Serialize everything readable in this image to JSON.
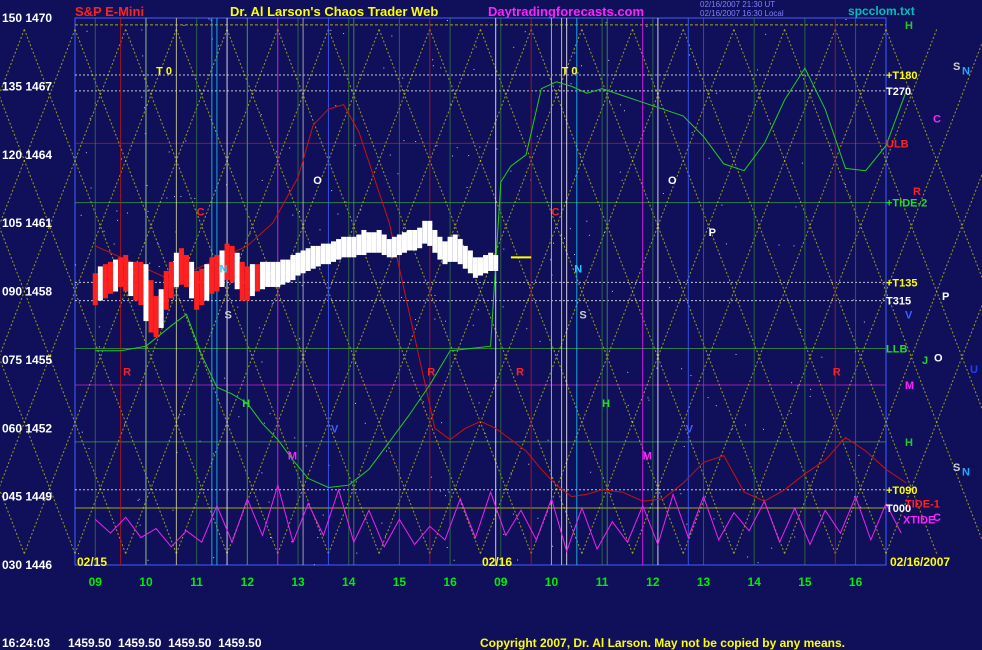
{
  "header": {
    "instrument": "S&P E-Mini",
    "site_title": "Dr. Al Larson's Chaos Trader Web",
    "site_url": "Daytradingforecasts.com",
    "stamp1": "02/16/2007 21:30 UT",
    "stamp2": "02/16/2007 16:30 Local",
    "file": "spcclom.txt"
  },
  "footer": {
    "time": "16:24:03",
    "quotes": "1459.50  1459.50  1459.50  1459.50",
    "copyright": "Copyright 2007, Dr. Al Larson. May not be copied by any means."
  },
  "colors": {
    "background": "#10105a",
    "axis_text": "#ffffff",
    "x_text": "#00ee00",
    "grid_yellow": "#d8d800",
    "grid_green": "#3fa03f",
    "price_bar": "#ffffff",
    "price_bar_red": "#ff2020",
    "tide_green": "#22cc22",
    "line_red": "#cc1010",
    "xtide_magenta": "#ee22ee"
  },
  "chart_data": {
    "type": "line",
    "title": "S&P E-Mini",
    "xlabel": "",
    "ylabel": "",
    "ylim": [
      1446,
      1470
    ],
    "y_ticks": [
      {
        "left": "150",
        "value": 1470
      },
      {
        "left": "135",
        "value": 1467
      },
      {
        "left": "120",
        "value": 1464
      },
      {
        "left": "105",
        "value": 1461
      },
      {
        "left": "090",
        "value": 1458
      },
      {
        "left": "075",
        "value": 1455
      },
      {
        "left": "060",
        "value": 1452
      },
      {
        "left": "045",
        "value": 1449
      },
      {
        "left": "030",
        "value": 1446
      }
    ],
    "x_ticks": [
      "09",
      "10",
      "11",
      "12",
      "13",
      "14",
      "15",
      "16",
      "09",
      "10",
      "11",
      "12",
      "13",
      "14",
      "15",
      "16"
    ],
    "date_labels": [
      "02/15",
      "02/16",
      "02/16/2007"
    ],
    "last_price": 1459.5,
    "right_labels": [
      {
        "text": "H",
        "value": 1469.7,
        "color": "#22cc22"
      },
      {
        "text": "+T180",
        "value": 1467.5,
        "color": "#ffff00"
      },
      {
        "text": "T270",
        "value": 1466.8,
        "color": "#ffffff"
      },
      {
        "text": "ULB",
        "value": 1464.5,
        "color": "#ff2020"
      },
      {
        "text": "+TIDE-2",
        "value": 1461.9,
        "color": "#22dd22"
      },
      {
        "text": "+T135",
        "value": 1458.4,
        "color": "#ffff00"
      },
      {
        "text": "T315",
        "value": 1457.6,
        "color": "#ffffff"
      },
      {
        "text": "V",
        "value": 1457.0,
        "color": "#4060ff"
      },
      {
        "text": "LLB",
        "value": 1455.5,
        "color": "#22dd22"
      },
      {
        "text": "M",
        "value": 1453.9,
        "color": "#ff22ff"
      },
      {
        "text": "H",
        "value": 1451.4,
        "color": "#22cc22"
      },
      {
        "text": "+T090",
        "value": 1449.3,
        "color": "#ffff00"
      },
      {
        "text": "T000",
        "value": 1448.5,
        "color": "#ffffff"
      },
      {
        "text": "TIDE-1",
        "value": 1448.7,
        "color": "#ff2020"
      },
      {
        "text": "XTIDE",
        "value": 1448.0,
        "color": "#ff22ff"
      }
    ],
    "far_right_labels": [
      {
        "text": "S",
        "value": 1467.9,
        "color": "#cccccc"
      },
      {
        "text": "N",
        "value": 1467.7,
        "color": "#22aaff"
      },
      {
        "text": "C",
        "value": 1465.6,
        "color": "#ff22ff"
      },
      {
        "text": "R",
        "value": 1462.4,
        "color": "#ff2020"
      },
      {
        "text": "P",
        "value": 1457.8,
        "color": "#ffffff"
      },
      {
        "text": "J",
        "value": 1455.0,
        "color": "#22dd22"
      },
      {
        "text": "O",
        "value": 1455.1,
        "color": "#ffffff"
      },
      {
        "text": "U",
        "value": 1454.6,
        "color": "#2040ff"
      },
      {
        "text": "S",
        "value": 1450.3,
        "color": "#cccccc"
      },
      {
        "text": "N",
        "value": 1450.1,
        "color": "#22aaff"
      },
      {
        "text": "C",
        "value": 1448.1,
        "color": "#ff22ff"
      }
    ],
    "plot_labels": [
      {
        "text": "T 0",
        "t": 1.2,
        "value": 1467.7,
        "color": "#ffff00"
      },
      {
        "text": "T 0",
        "t": 9.2,
        "value": 1467.7,
        "color": "#ffff00"
      },
      {
        "text": "O",
        "t": 4.3,
        "value": 1462.9,
        "color": "#ffffff"
      },
      {
        "text": "O",
        "t": 11.3,
        "value": 1462.9,
        "color": "#ffffff"
      },
      {
        "text": "C",
        "t": 2.0,
        "value": 1461.5,
        "color": "#ff2020"
      },
      {
        "text": "C",
        "t": 9.0,
        "value": 1461.5,
        "color": "#ff2020"
      },
      {
        "text": "P",
        "t": 12.1,
        "value": 1460.6,
        "color": "#ffffff"
      },
      {
        "text": "N",
        "t": 2.45,
        "value": 1459.0,
        "color": "#22ccff"
      },
      {
        "text": "N",
        "t": 9.45,
        "value": 1459.0,
        "color": "#22ccff"
      },
      {
        "text": "S",
        "t": 2.55,
        "value": 1457.0,
        "color": "#cccccc"
      },
      {
        "text": "S",
        "t": 9.55,
        "value": 1457.0,
        "color": "#cccccc"
      },
      {
        "text": "R",
        "t": 0.55,
        "value": 1454.5,
        "color": "#ff2020"
      },
      {
        "text": "R",
        "t": 6.55,
        "value": 1454.5,
        "color": "#ff2020"
      },
      {
        "text": "R",
        "t": 8.3,
        "value": 1454.5,
        "color": "#ff2020"
      },
      {
        "text": "R",
        "t": 14.55,
        "value": 1454.5,
        "color": "#ff2020"
      },
      {
        "text": "H",
        "t": 2.9,
        "value": 1453.1,
        "color": "#22dd22"
      },
      {
        "text": "H",
        "t": 10.0,
        "value": 1453.1,
        "color": "#22dd22"
      },
      {
        "text": "V",
        "t": 4.65,
        "value": 1452.0,
        "color": "#4060ff"
      },
      {
        "text": "V",
        "t": 11.65,
        "value": 1452.0,
        "color": "#4060ff"
      },
      {
        "text": "M",
        "t": 3.8,
        "value": 1450.8,
        "color": "#ff22ff"
      },
      {
        "text": "M",
        "t": 10.8,
        "value": 1450.8,
        "color": "#ff22ff"
      }
    ],
    "series": [
      {
        "name": "",
        "kind": "price_bars",
        "t": [
          0.0,
          0.1,
          0.2,
          0.3,
          0.4,
          0.5,
          0.6,
          0.7,
          0.8,
          0.9,
          1.0,
          1.1,
          1.2,
          1.3,
          1.4,
          1.5,
          1.6,
          1.7,
          1.8,
          1.9,
          2.0,
          2.1,
          2.2,
          2.3,
          2.4,
          2.5,
          2.6,
          2.7,
          2.8,
          2.9,
          3.0,
          3.1,
          3.2,
          3.3,
          3.4,
          3.5,
          3.6,
          3.7,
          3.8,
          3.9,
          4.0,
          4.1,
          4.2,
          4.3,
          4.4,
          4.5,
          4.6,
          4.7,
          4.8,
          4.9,
          5.0,
          5.1,
          5.2,
          5.3,
          5.4,
          5.5,
          5.6,
          5.7,
          5.8,
          5.9,
          6.0,
          6.1,
          6.2,
          6.3,
          6.4,
          6.5,
          6.6,
          6.7,
          6.8,
          6.9,
          7.0,
          7.1,
          7.2,
          7.3,
          7.4,
          7.5,
          7.6,
          7.7,
          7.8,
          7.9
        ],
        "high": [
          1458.8,
          1459.1,
          1459.2,
          1459.3,
          1459.4,
          1459.5,
          1459.6,
          1459.3,
          1459.3,
          1459.3,
          1459.2,
          1458.5,
          1457.8,
          1458.1,
          1458.9,
          1459.3,
          1459.7,
          1459.9,
          1459.6,
          1459.3,
          1458.9,
          1459.0,
          1459.2,
          1459.5,
          1459.6,
          1459.8,
          1460.1,
          1460.0,
          1459.7,
          1459.3,
          1459.1,
          1459.2,
          1459.2,
          1459.3,
          1459.3,
          1459.3,
          1459.3,
          1459.4,
          1459.4,
          1459.6,
          1459.7,
          1459.8,
          1459.9,
          1460.0,
          1460.0,
          1460.1,
          1460.1,
          1460.2,
          1460.3,
          1460.4,
          1460.4,
          1460.4,
          1460.5,
          1460.7,
          1460.6,
          1460.6,
          1460.7,
          1460.5,
          1460.3,
          1460.4,
          1460.5,
          1460.6,
          1460.7,
          1460.7,
          1460.8,
          1461.1,
          1461.1,
          1460.7,
          1460.4,
          1460.2,
          1460.4,
          1460.5,
          1460.3,
          1460.0,
          1459.8,
          1459.5,
          1459.5,
          1459.6,
          1459.7,
          1459.6
        ],
        "low": [
          1457.4,
          1457.6,
          1457.7,
          1457.9,
          1458.0,
          1458.2,
          1458.0,
          1457.8,
          1457.6,
          1457.4,
          1456.7,
          1456.2,
          1456.0,
          1456.4,
          1457.2,
          1457.7,
          1458.2,
          1458.3,
          1458.2,
          1457.7,
          1457.2,
          1457.4,
          1457.6,
          1457.9,
          1458.0,
          1458.2,
          1458.5,
          1458.4,
          1458.1,
          1457.6,
          1457.6,
          1457.8,
          1458.0,
          1458.1,
          1458.2,
          1458.2,
          1458.2,
          1458.3,
          1458.4,
          1458.5,
          1458.7,
          1458.8,
          1458.9,
          1459.0,
          1459.1,
          1459.2,
          1459.2,
          1459.3,
          1459.4,
          1459.5,
          1459.5,
          1459.5,
          1459.6,
          1459.6,
          1459.7,
          1459.7,
          1459.7,
          1459.6,
          1459.5,
          1459.5,
          1459.6,
          1459.7,
          1459.8,
          1459.8,
          1459.9,
          1460.1,
          1460.0,
          1459.7,
          1459.4,
          1459.2,
          1459.3,
          1459.3,
          1459.2,
          1459.0,
          1458.8,
          1458.6,
          1458.7,
          1458.8,
          1458.9,
          1458.9
        ]
      },
      {
        "name": "",
        "kind": "tide_green",
        "t": [
          0,
          0.5,
          1.0,
          1.5,
          1.8,
          2.1,
          2.4,
          2.7,
          3.0,
          3.3,
          3.6,
          3.9,
          4.2,
          4.6,
          5.0,
          5.4,
          5.8,
          6.2,
          6.6,
          7.0,
          7.4,
          7.8,
          8.0,
          8.2,
          8.5,
          8.8,
          9.1,
          9.4,
          9.7,
          10.0,
          10.4,
          10.8,
          11.2,
          11.6,
          12.0,
          12.4,
          12.8,
          13.2,
          13.6,
          14.0,
          14.4,
          14.8,
          15.2,
          15.6,
          16.0
        ],
        "values": [
          1455.4,
          1455.4,
          1455.6,
          1456.5,
          1457.0,
          1455.2,
          1453.8,
          1453.5,
          1453.1,
          1452.2,
          1451.5,
          1450.6,
          1449.8,
          1449.4,
          1449.5,
          1450.2,
          1451.4,
          1452.6,
          1453.9,
          1455.4,
          1455.5,
          1455.6,
          1462.8,
          1463.5,
          1464.0,
          1466.9,
          1467.2,
          1467.0,
          1466.7,
          1466.9,
          1466.6,
          1466.3,
          1466.0,
          1465.7,
          1464.8,
          1463.6,
          1463.3,
          1464.5,
          1466.4,
          1467.8,
          1466.0,
          1463.4,
          1463.3,
          1464.4,
          1466.8
        ]
      },
      {
        "name": "",
        "kind": "line_red",
        "t": [
          0,
          0.5,
          1.0,
          1.5,
          2.0,
          2.5,
          3.0,
          3.5,
          4.0,
          4.3,
          4.6,
          4.9,
          5.2,
          5.5,
          5.8,
          6.1,
          6.4,
          6.7,
          7.0,
          7.3,
          7.6,
          7.9,
          8.2,
          8.5,
          8.8,
          9.1,
          9.4,
          9.7,
          10.0,
          10.4,
          10.8,
          11.2,
          11.6,
          12.0,
          12.4,
          12.8,
          13.2,
          13.6,
          14.0,
          14.4,
          14.8,
          15.2,
          15.6,
          16.0
        ],
        "values": [
          1460.0,
          1459.5,
          1459.0,
          1458.5,
          1459.0,
          1459.5,
          1460.0,
          1461.0,
          1463.0,
          1465.3,
          1466.0,
          1466.2,
          1465.0,
          1463.0,
          1461.0,
          1458.0,
          1455.0,
          1452.0,
          1451.5,
          1452.0,
          1452.3,
          1452.0,
          1451.5,
          1451.0,
          1450.2,
          1449.5,
          1449.0,
          1449.1,
          1449.3,
          1449.2,
          1448.8,
          1448.9,
          1449.6,
          1450.5,
          1450.8,
          1449.2,
          1448.8,
          1449.3,
          1450.0,
          1450.6,
          1451.6,
          1451.0,
          1450.2,
          1449.6
        ]
      },
      {
        "name": "",
        "kind": "xtide_magenta",
        "t": [
          0,
          0.3,
          0.6,
          0.9,
          1.2,
          1.5,
          1.8,
          2.1,
          2.4,
          2.7,
          3.0,
          3.3,
          3.6,
          3.9,
          4.2,
          4.5,
          4.8,
          5.1,
          5.4,
          5.7,
          6.0,
          6.3,
          6.6,
          6.9,
          7.2,
          7.5,
          7.8,
          8.1,
          8.4,
          8.7,
          9.0,
          9.3,
          9.6,
          9.9,
          10.2,
          10.5,
          10.8,
          11.1,
          11.4,
          11.7,
          12.0,
          12.3,
          12.6,
          12.9,
          13.2,
          13.5,
          13.8,
          14.1,
          14.4,
          14.7,
          15.0,
          15.3,
          15.6,
          15.9
        ],
        "values": [
          1448.0,
          1447.4,
          1448.1,
          1447.2,
          1447.6,
          1446.8,
          1447.5,
          1447.0,
          1448.6,
          1447.0,
          1448.9,
          1447.3,
          1449.5,
          1447.0,
          1448.7,
          1447.3,
          1449.3,
          1447.0,
          1448.4,
          1446.8,
          1448.0,
          1446.9,
          1447.7,
          1447.1,
          1448.9,
          1447.2,
          1449.2,
          1447.3,
          1448.4,
          1447.1,
          1448.9,
          1446.6,
          1448.5,
          1446.7,
          1447.9,
          1447.0,
          1448.6,
          1446.9,
          1449.1,
          1447.2,
          1449.0,
          1447.1,
          1448.3,
          1447.5,
          1448.8,
          1447.0,
          1448.5,
          1446.9,
          1448.4,
          1447.4,
          1449.0,
          1447.1,
          1448.7,
          1447.4
        ]
      }
    ]
  }
}
